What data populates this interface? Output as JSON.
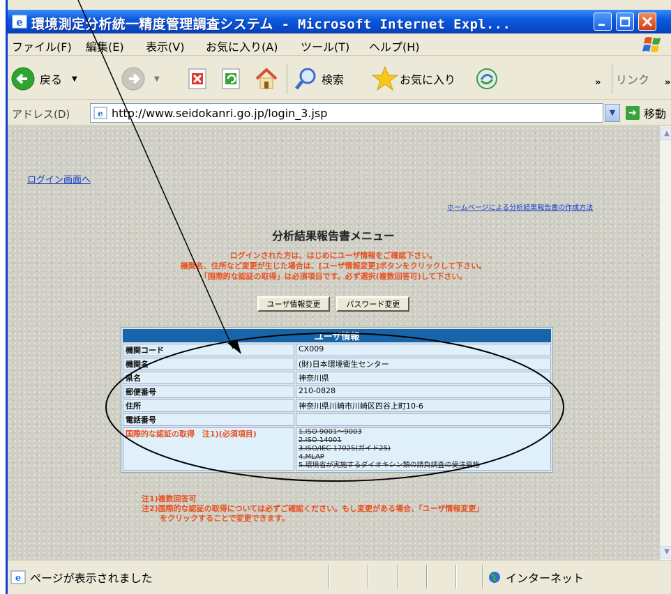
{
  "window": {
    "title": "環境測定分析統一精度管理調査システム - Microsoft Internet Expl..."
  },
  "menu": [
    "ファイル(F)",
    "編集(E)",
    "表示(V)",
    "お気に入り(A)",
    "ツール(T)",
    "ヘルプ(H)"
  ],
  "toolbar": {
    "back_label": "戻る",
    "search_label": "検索",
    "favorites_label": "お気に入り",
    "more": "»",
    "links_label": "リンク"
  },
  "address": {
    "label": "アドレス(D)",
    "url": "http://www.seidokanri.go.jp/login_3.jsp",
    "go_label": "移動"
  },
  "page": {
    "login_link": "ログイン画面へ",
    "howto_link": "ホームページによる分析結果報告書の作成方法",
    "heading": "分析結果報告書メニュー",
    "notice_lines": [
      "ログインされた方は、はじめにユーザ情報をご確認下さい。",
      "機関名、住所など変更が生じた場合は、[ユーザ情報変更]ボタンをクリックして下さい。",
      "「国際的な認証の取得」は必須項目です。必ず選択(複数回答可)して下さい。"
    ],
    "buttons": {
      "user_info_change": "ユーザ情報変更",
      "password_change": "パスワード変更"
    },
    "user_info": {
      "header": "ユーザ情報",
      "rows": [
        {
          "label": "機関コード",
          "value": "CX009"
        },
        {
          "label": "機関名",
          "value": "(財)日本環境衛生センター"
        },
        {
          "label": "県名",
          "value": "神奈川県"
        },
        {
          "label": "郵便番号",
          "value": "210-0828"
        },
        {
          "label": "住所",
          "value": "神奈川県川崎市川崎区四谷上町10-6"
        },
        {
          "label": "電話番号",
          "value": ""
        }
      ],
      "cert_label": "国際的な認証の取得　注1)(必須項目)",
      "cert_items": [
        "1.ISO 9001～9003",
        "2.ISO 14001",
        "3.ISO/IEC 17025(ガイド25)",
        "4.MLAP",
        "5.環境省が実施するダイオキシン類の請負調査の受注資格"
      ]
    },
    "notes": [
      "注1)複数回答可",
      "注2)国際的な認証の取得については必ずご確認ください。もし変更がある場合、「ユーザ情報変更」",
      "をクリックすることで変更できます。"
    ]
  },
  "status": {
    "text": "ページが表示されました",
    "zone": "インターネット"
  }
}
